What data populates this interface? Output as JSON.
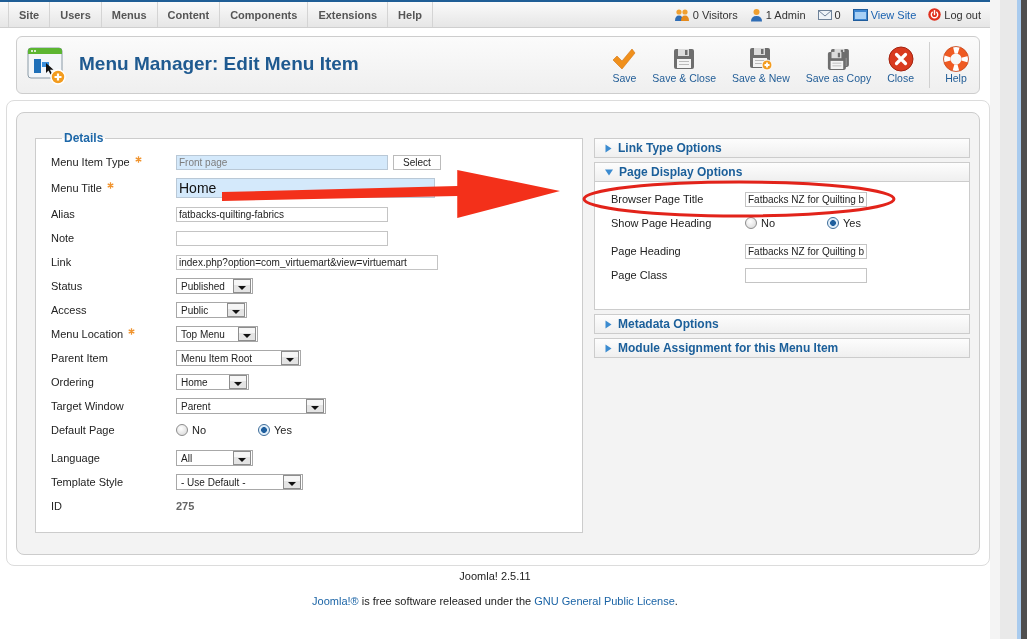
{
  "menu_bar": {
    "items": [
      "Site",
      "Users",
      "Menus",
      "Content",
      "Components",
      "Extensions",
      "Help"
    ],
    "status": [
      {
        "kind": "visitors",
        "text": "0 Visitors"
      },
      {
        "kind": "admin",
        "text": "1 Admin"
      },
      {
        "kind": "messages",
        "text": "0"
      },
      {
        "kind": "view_site",
        "text": "View Site"
      },
      {
        "kind": "logout",
        "text": "Log out"
      }
    ]
  },
  "toolbar": {
    "title": "Menu Manager: Edit Menu Item",
    "buttons": [
      {
        "kind": "save",
        "label": "Save"
      },
      {
        "kind": "save_close",
        "label": "Save & Close"
      },
      {
        "kind": "save_new",
        "label": "Save & New"
      },
      {
        "kind": "save_copy",
        "label": "Save as Copy"
      },
      {
        "kind": "close",
        "label": "Close"
      },
      {
        "kind": "help",
        "label": "Help"
      }
    ]
  },
  "details": {
    "legend": "Details",
    "fields": [
      {
        "kind": "type",
        "label": "Menu Item Type",
        "required": true,
        "value": "Front page",
        "button": "Select"
      },
      {
        "kind": "title",
        "label": "Menu Title",
        "required": true,
        "value": "Home"
      },
      {
        "kind": "text",
        "label": "Alias",
        "required": false,
        "value": "fatbacks-quilting-fabrics"
      },
      {
        "kind": "text",
        "label": "Note",
        "required": false
      },
      {
        "kind": "text",
        "label": "Link",
        "required": false,
        "value": "index.php?option=com_virtuemart&view=virtuemart"
      },
      {
        "kind": "select",
        "label": "Status",
        "required": false,
        "value": "Published"
      },
      {
        "kind": "select",
        "label": "Access",
        "required": false,
        "value": "Public"
      },
      {
        "kind": "select",
        "label": "Menu Location",
        "required": true,
        "value": "Top Menu"
      },
      {
        "kind": "select",
        "label": "Parent Item",
        "required": false,
        "value": "Menu Item Root"
      },
      {
        "kind": "select",
        "label": "Ordering",
        "required": false,
        "value": "Home"
      },
      {
        "kind": "select",
        "label": "Target Window",
        "required": false,
        "value": "Parent"
      },
      {
        "kind": "radio",
        "label": "Default Page",
        "required": false,
        "options": [
          {
            "label": "No",
            "selected": false
          },
          {
            "label": "Yes",
            "selected": true
          }
        ]
      },
      {
        "kind": "select",
        "label": "Language",
        "required": false,
        "value": "All"
      },
      {
        "kind": "select",
        "label": "Template Style",
        "required": false,
        "value": "- Use Default -"
      },
      {
        "kind": "static",
        "label": "ID",
        "required": false,
        "value": "275"
      }
    ]
  },
  "panels": [
    {
      "title": "Link Type Options",
      "expanded": false
    },
    {
      "title": "Page Display Options",
      "expanded": true,
      "fields": [
        {
          "kind": "text",
          "label": "Browser Page Title",
          "value": "Fatbacks NZ for Quilting b"
        },
        {
          "kind": "radio",
          "label": "Show Page Heading",
          "options": [
            {
              "label": "No",
              "selected": false
            },
            {
              "label": "Yes",
              "selected": true
            }
          ]
        },
        {
          "kind": "text",
          "label": "Page Heading",
          "value": "Fatbacks NZ for Quilting b"
        },
        {
          "kind": "text",
          "label": "Page Class"
        }
      ]
    },
    {
      "title": "Metadata Options",
      "expanded": false
    },
    {
      "title": "Module Assignment for this Menu Item",
      "expanded": false
    }
  ],
  "annotations": [
    {
      "kind": "arrow"
    },
    {
      "kind": "ellipse"
    }
  ],
  "footer": {
    "version": "Joomla! 2.5.11",
    "license": [
      {
        "text": "Joomla!®",
        "link": true
      },
      {
        "text": " is free software released under the ",
        "link": false
      },
      {
        "text": "GNU General Public License",
        "link": true
      },
      {
        "text": ".",
        "link": false
      }
    ]
  }
}
